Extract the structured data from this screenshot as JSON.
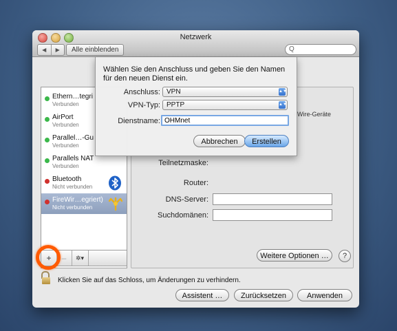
{
  "window": {
    "title": "Netzwerk",
    "show_all": "Alle einblenden",
    "back_glyph": "◀",
    "forward_glyph": "▶",
    "search_glyph": "Q"
  },
  "services": [
    {
      "name": "Ethern…tegri",
      "status": "Verbunden",
      "state_color": "#3bb84a"
    },
    {
      "name": "AirPort",
      "status": "Verbunden",
      "state_color": "#3bb84a"
    },
    {
      "name": "Parallel…-Gu",
      "status": "Verbunden",
      "state_color": "#3bb84a"
    },
    {
      "name": "Parallels NAT",
      "status": "Verbunden",
      "state_color": "#3bb84a"
    },
    {
      "name": "Bluetooth",
      "status": "Nicht verbunden",
      "state_color": "#d0312d",
      "icon": "bluetooth-icon"
    },
    {
      "name": "FireWir…egriert)",
      "status": "Nicht verbunden",
      "state_color": "#d0312d",
      "icon": "firewire-icon",
      "selected": true
    }
  ],
  "sidebar_bottom": {
    "add": "+",
    "remove": "–",
    "gear": "✲▾"
  },
  "panel": {
    "side_text": "eWire-Geräte",
    "subnet_label": "Teilnetzmaske:",
    "router_label": "Router:",
    "dns_label": "DNS-Server:",
    "search_domains_label": "Suchdomänen:",
    "advanced_button": "Weitere Optionen …",
    "help": "?"
  },
  "sheet": {
    "intro": "Wählen Sie den Anschluss und geben Sie den Namen für den neuen Dienst ein.",
    "connection_label": "Anschluss:",
    "connection_value": "VPN",
    "vpn_type_label": "VPN-Typ:",
    "vpn_type_value": "PPTP",
    "service_name_label": "Dienstname:",
    "service_name_value": "OHMnet",
    "cancel": "Abbrechen",
    "create": "Erstellen",
    "arrow_glyph": "▲▼"
  },
  "footer": {
    "lock_text": "Klicken Sie auf das Schloss, um Änderungen zu verhindern.",
    "assistant": "Assistent …",
    "revert": "Zurücksetzen",
    "apply": "Anwenden"
  }
}
